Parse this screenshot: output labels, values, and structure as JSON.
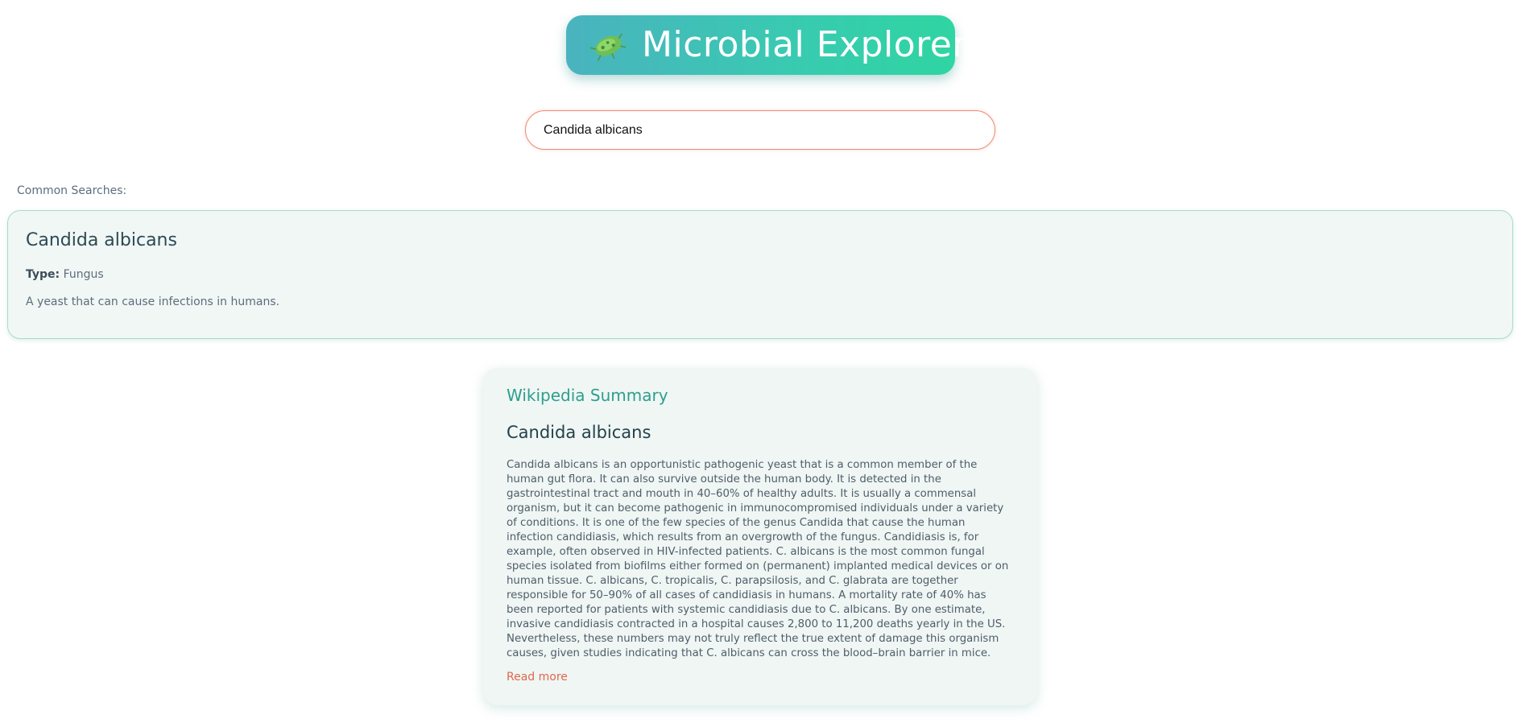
{
  "header": {
    "title": "Microbial Explorer",
    "icon": "microbe-icon"
  },
  "search": {
    "value": "Candida albicans",
    "placeholder": ""
  },
  "common_searches": {
    "label": "Common Searches:"
  },
  "result": {
    "name": "Candida albicans",
    "type_label": "Type:",
    "type_value": "Fungus",
    "description": "A yeast that can cause infections in humans."
  },
  "wikipedia": {
    "heading": "Wikipedia Summary",
    "title": "Candida albicans",
    "summary": "Candida albicans is an opportunistic pathogenic yeast that is a common member of the human gut flora. It can also survive outside the human body. It is detected in the gastrointestinal tract and mouth in 40–60% of healthy adults. It is usually a commensal organism, but it can become pathogenic in immunocompromised individuals under a variety of conditions. It is one of the few species of the genus Candida that cause the human infection candidiasis, which results from an overgrowth of the fungus. Candidiasis is, for example, often observed in HIV-infected patients. C. albicans is the most common fungal species isolated from biofilms either formed on (permanent) implanted medical devices or on human tissue. C. albicans, C. tropicalis, C. parapsilosis, and C. glabrata are together responsible for 50–90% of all cases of candidiasis in humans. A mortality rate of 40% has been reported for patients with systemic candidiasis due to C. albicans. By one estimate, invasive candidiasis contracted in a hospital causes 2,800 to 11,200 deaths yearly in the US. Nevertheless, these numbers may not truly reflect the true extent of damage this organism causes, given studies indicating that C. albicans can cross the blood–brain barrier in mice.",
    "read_more": "Read more"
  },
  "colors": {
    "header_gradient_start": "#4ab3bf",
    "header_gradient_end": "#2fd5a2",
    "search_border": "#ef8a73",
    "wiki_heading": "#2e9e8f",
    "read_more": "#e0674f",
    "card_background": "#f1f7f4",
    "card_border": "#a8dcc4"
  }
}
